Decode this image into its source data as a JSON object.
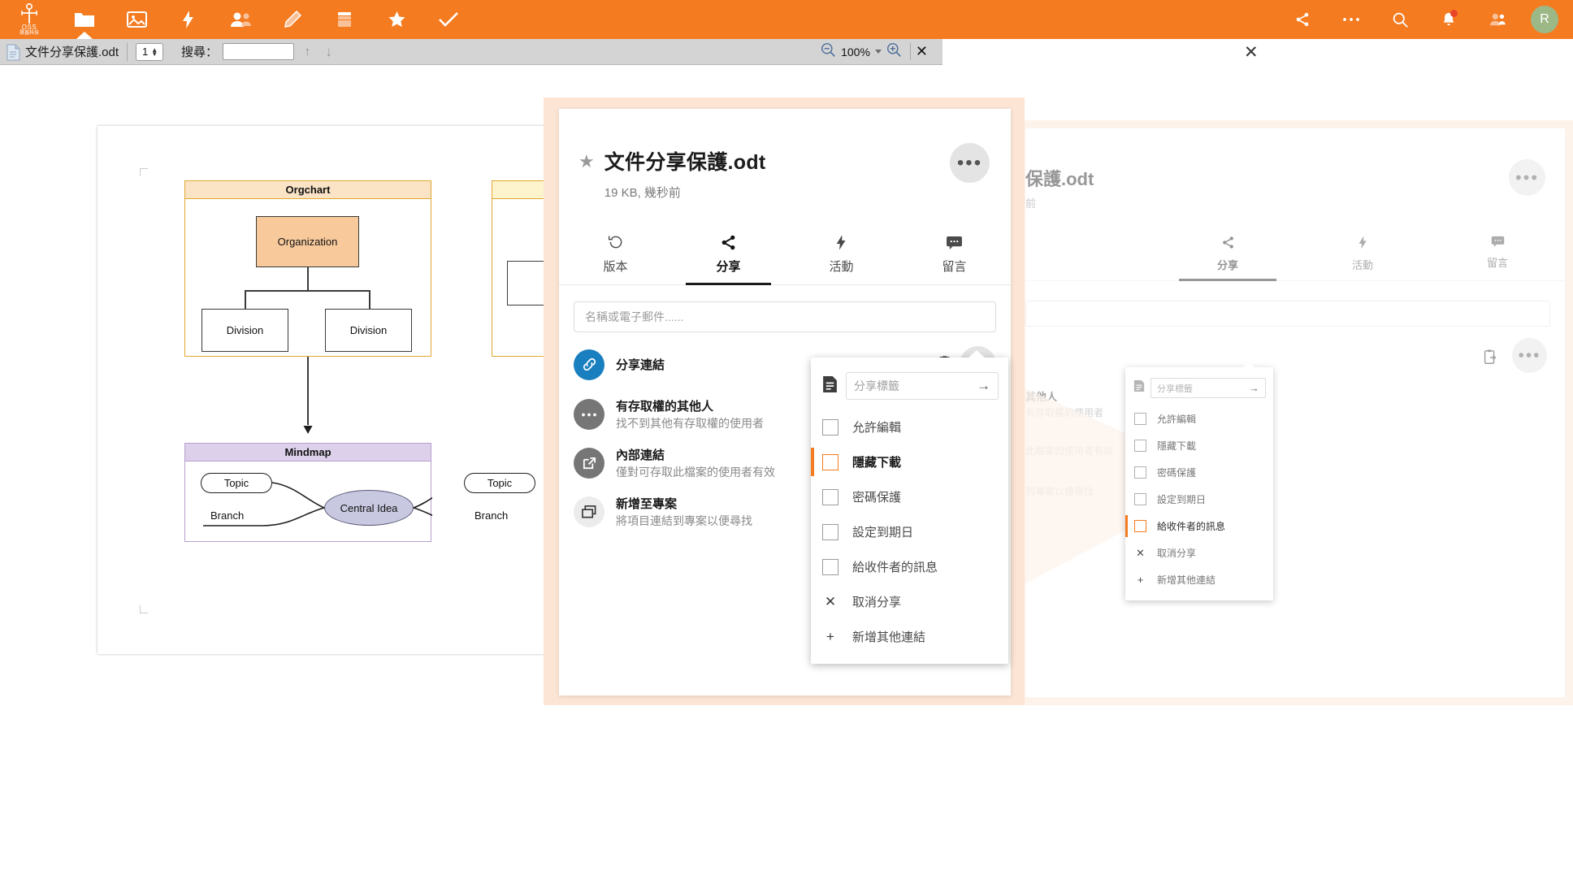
{
  "topbar": {
    "logo_text": "OSS",
    "logo_sub": "晟鑫科技",
    "icons": [
      {
        "name": "files-icon",
        "active": true
      },
      {
        "name": "photos-icon",
        "active": false
      },
      {
        "name": "activity-icon",
        "active": false
      },
      {
        "name": "contacts-icon",
        "active": false
      },
      {
        "name": "notes-icon",
        "active": false
      },
      {
        "name": "archive-icon",
        "active": false
      },
      {
        "name": "favorites-icon",
        "active": false
      },
      {
        "name": "tasks-icon",
        "active": false
      }
    ],
    "right_icons": [
      "share-icon",
      "more-icon",
      "search-icon",
      "notifications-icon",
      "contacts-icon"
    ],
    "avatar_letter": "R"
  },
  "viewer": {
    "doc_name": "文件分享保護.odt",
    "page_number": "1",
    "search_label": "搜尋：",
    "search_value": "",
    "zoom_level": "100%",
    "close_label": "✕"
  },
  "document": {
    "orgchart": {
      "header": "Orgchart",
      "root": "Organization",
      "children": [
        "Division",
        "Division"
      ]
    },
    "mindmap": {
      "header": "Mindmap",
      "center": "Central Idea",
      "topics": [
        "Topic",
        "Topic"
      ],
      "branches": [
        "Branch",
        "Branch"
      ]
    }
  },
  "detail_panel": {
    "title": "文件分享保護.odt",
    "subtitle": "19 KB, 幾秒前",
    "star": "★",
    "more": "•••",
    "tabs": [
      {
        "label": "版本",
        "icon": "history-icon",
        "active": false
      },
      {
        "label": "分享",
        "icon": "share-icon",
        "active": true
      },
      {
        "label": "活動",
        "icon": "activity-icon",
        "active": false
      },
      {
        "label": "留言",
        "icon": "comment-icon",
        "active": false
      }
    ],
    "share_input_placeholder": "名稱或電子郵件......",
    "share_rows": [
      {
        "title": "分享連結",
        "subtitle": "",
        "avatar": "link-icon",
        "avatar_style": "blue"
      },
      {
        "title": "有存取權的其他人",
        "subtitle": "找不到其他有存取權的使用者",
        "avatar": "more-icon",
        "avatar_style": "grey"
      },
      {
        "title": "內部連結",
        "subtitle": "僅對可存取此檔案的使用者有效",
        "avatar": "external-link-icon",
        "avatar_style": "grey"
      },
      {
        "title": "新增至專案",
        "subtitle": "將項目連結到專案以便尋找",
        "avatar": "project-icon",
        "avatar_style": "light"
      }
    ],
    "row_actions": {
      "copy": "copy-to-clipboard-icon",
      "more": "•••"
    }
  },
  "share_menu": {
    "tag_placeholder": "分享標籤",
    "tag_submit": "→",
    "items": [
      {
        "label": "允許編輯",
        "type": "checkbox",
        "checked": false,
        "selected": false
      },
      {
        "label": "隱藏下載",
        "type": "checkbox",
        "checked": false,
        "selected": true
      },
      {
        "label": "密碼保護",
        "type": "checkbox",
        "checked": false,
        "selected": false
      },
      {
        "label": "設定到期日",
        "type": "checkbox",
        "checked": false,
        "selected": false
      },
      {
        "label": "給收件者的訊息",
        "type": "checkbox",
        "checked": false,
        "selected": false
      },
      {
        "label": "取消分享",
        "type": "glyph",
        "glyph": "✕",
        "selected": false
      },
      {
        "label": "新增其他連結",
        "type": "glyph",
        "glyph": "+",
        "selected": false
      }
    ]
  },
  "ghost_panel": {
    "title": "保護.odt",
    "subtitle": "前",
    "more": "•••",
    "tabs": [
      {
        "label": "分享",
        "active": true
      },
      {
        "label": "活動",
        "active": false
      },
      {
        "label": "留言",
        "active": false
      }
    ],
    "rows": [
      {
        "title": "其他人",
        "subtitle": "有存取權的使用者"
      }
    ],
    "menu": {
      "tag_placeholder": "分享標籤",
      "tag_submit": "→",
      "items": [
        {
          "label": "允許編輯",
          "type": "checkbox",
          "selected": false
        },
        {
          "label": "隱藏下載",
          "type": "checkbox",
          "selected": false
        },
        {
          "label": "密碼保護",
          "type": "checkbox",
          "selected": false
        },
        {
          "label": "設定到期日",
          "type": "checkbox",
          "selected": false
        },
        {
          "label": "給收件者的訊息",
          "type": "checkbox",
          "selected": true
        },
        {
          "label": "取消分享",
          "type": "glyph",
          "glyph": "✕",
          "selected": false
        },
        {
          "label": "新增其他連結",
          "type": "glyph",
          "glyph": "+",
          "selected": false
        }
      ]
    }
  },
  "colors": {
    "accent": "#f47b20",
    "panel_border": "#fce5d4",
    "avatar_bg": "#9db887",
    "link_blue": "#1a7fbf"
  }
}
